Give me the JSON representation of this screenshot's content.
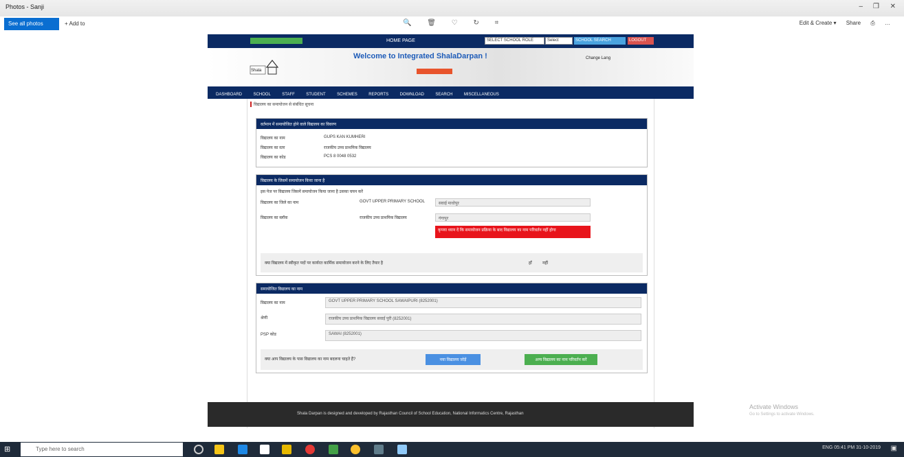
{
  "window": {
    "title": "Photos - Sanji",
    "min": "–",
    "max": "❐",
    "close": "✕"
  },
  "appbar": {
    "see_all": "See all photos",
    "add_to": "+ Add to",
    "edit_create": "Edit & Create ▾",
    "share": "Share",
    "tool_icons": [
      "zoom-icon",
      "delete-icon",
      "favorite-icon",
      "rotate-icon",
      "crop-icon"
    ]
  },
  "site": {
    "top_home": "HOME PAGE",
    "select_school": "SELECT SCHOOL ROLE",
    "select2": "Select",
    "btn_blue": "SCHOOL SEARCH",
    "btn_red": "LOGOUT",
    "welcome": "Welcome to Integrated ShalaDarpan !",
    "lang": "Change Lang",
    "nav": [
      "DASHBOARD",
      "SCHOOL",
      "STAFF",
      "STUDENT",
      "SCHEMES",
      "REPORTS",
      "DOWNLOAD",
      "SEARCH",
      "MISCELLANEOUS"
    ],
    "breadcrumb": "विद्यालय का समायोजन से संबंधित सूचना",
    "panel1": {
      "title": "वर्तमान में समायोजित होने वाले विद्यालय का विवरण",
      "rows": [
        [
          "विद्यालय का नाम",
          "GUPS KAN KUMHERI"
        ],
        [
          "विद्यालय का स्तर",
          "राजकीय उच्च प्राथमिक विद्यालय"
        ],
        [
          "विद्यालय का कोड",
          "PCS 8 0048 0532"
        ]
      ]
    },
    "panel2": {
      "title": "विद्यालय के जिसमें समायोजन किया जाना है",
      "note": "इस पेज पर विद्यालय जिसमें समायोजन किया जाना है उसका चयन करें",
      "l1": "विद्यालय का जिले का नाम",
      "l2": "विद्यालय का ब्लॉक",
      "c1": "GOVT UPPER PRIMARY SCHOOL",
      "c2": "राजकीय उच्च प्राथमिक विद्यालय",
      "v1": "सवाई माधोपुर",
      "v2": "गंगापुर",
      "alert": "कृपया ध्यान दें कि समायोजन प्रक्रिया के बाद विद्यालय का नाम परिवर्तन नहीं होगा",
      "q": "क्या विद्यालय में स्वीकृत पदों पर कार्यरत कार्मिक समायोजन करने के लिए तैयार है",
      "yes": "हाँ",
      "no": "नहीं"
    },
    "panel3": {
      "title": "समायोजित विद्यालय का नाम",
      "rows": [
        [
          "विद्यालय का नाम",
          "GOVT UPPER PRIMARY SCHOOL SAWAIPURI (8252001)"
        ],
        [
          "श्रेणी",
          "राजकीय उच्च प्राथमिक विद्यालय सवाई पुरी (8252001)"
        ],
        [
          "PSP कोड",
          "SAWAI (8252001)"
        ]
      ],
      "q": "क्या आप विद्यालय के पास विद्यालय का नाम बदलना चाहते हैं?",
      "b1": "नया विद्यालय जोड़ें",
      "b2": "अन्य विद्यालय का नाम परिवर्तन करें"
    },
    "footer": "Shala Darpan is designed and developed by Rajasthan Council of School Education, National Informatics Centre, Rajasthan"
  },
  "activate": {
    "l1": "Activate Windows",
    "l2": "Go to Settings to activate Windows."
  },
  "taskbar": {
    "search": "Type here to search",
    "time": "05:41 PM",
    "date": "31-10-2019",
    "lang": "ENG"
  }
}
